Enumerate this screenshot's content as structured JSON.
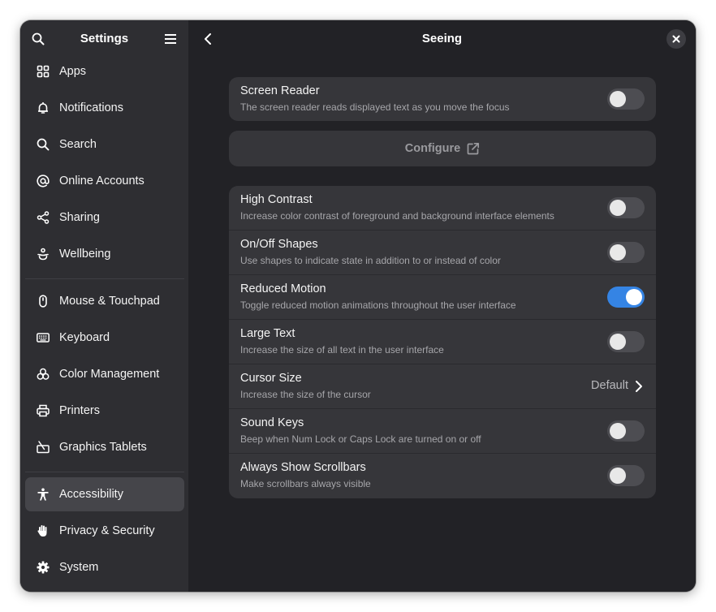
{
  "sidebar": {
    "title": "Settings",
    "items": [
      {
        "label": "Apps",
        "icon": "apps-grid-icon"
      },
      {
        "label": "Notifications",
        "icon": "bell-icon"
      },
      {
        "label": "Search",
        "icon": "search-icon"
      },
      {
        "label": "Online Accounts",
        "icon": "at-sign-icon"
      },
      {
        "label": "Sharing",
        "icon": "share-icon"
      },
      {
        "label": "Wellbeing",
        "icon": "wellbeing-icon"
      },
      {
        "label": "Mouse & Touchpad",
        "icon": "mouse-icon"
      },
      {
        "label": "Keyboard",
        "icon": "keyboard-icon"
      },
      {
        "label": "Color Management",
        "icon": "color-palette-icon"
      },
      {
        "label": "Printers",
        "icon": "printer-icon"
      },
      {
        "label": "Graphics Tablets",
        "icon": "tablet-pen-icon"
      },
      {
        "label": "Accessibility",
        "icon": "accessibility-icon",
        "selected": true
      },
      {
        "label": "Privacy & Security",
        "icon": "hand-icon"
      },
      {
        "label": "System",
        "icon": "gear-icon"
      }
    ]
  },
  "content": {
    "title": "Seeing",
    "screen_reader": {
      "title": "Screen Reader",
      "subtitle": "The screen reader reads displayed text as you move the focus",
      "enabled": false
    },
    "configure_label": "Configure",
    "rows": [
      {
        "title": "High Contrast",
        "subtitle": "Increase color contrast of foreground and background interface elements",
        "enabled": false
      },
      {
        "title": "On/Off Shapes",
        "subtitle": "Use shapes to indicate state in addition to or instead of color",
        "enabled": false
      },
      {
        "title": "Reduced Motion",
        "subtitle": "Toggle reduced motion animations throughout the user interface",
        "enabled": true
      },
      {
        "title": "Large Text",
        "subtitle": "Increase the size of all text in the user interface",
        "enabled": false
      },
      {
        "title": "Cursor Size",
        "subtitle": "Increase the size of the cursor",
        "value": "Default"
      },
      {
        "title": "Sound Keys",
        "subtitle": "Beep when Num Lock or Caps Lock are turned on or off",
        "enabled": false
      },
      {
        "title": "Always Show Scrollbars",
        "subtitle": "Make scrollbars always visible",
        "enabled": false
      }
    ]
  },
  "colors": {
    "accent": "#3584e4",
    "sidebar_bg": "#2e2e32",
    "content_bg": "#222226",
    "card_bg": "#36363a"
  }
}
